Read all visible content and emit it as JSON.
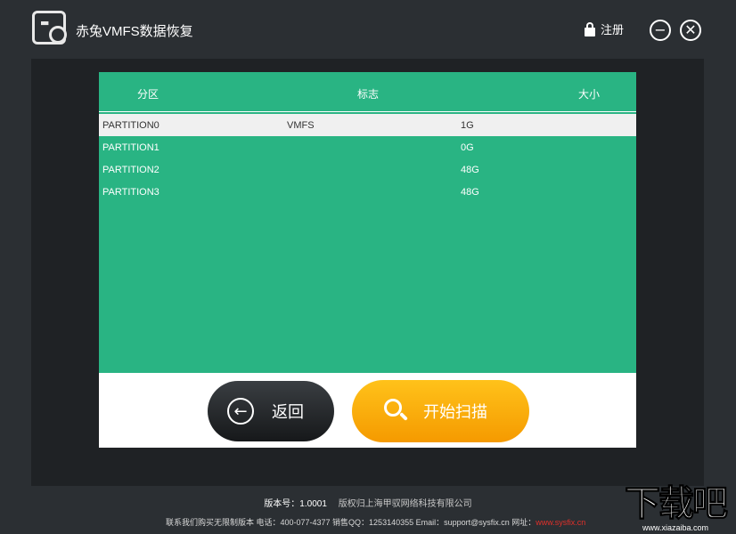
{
  "window": {
    "title": "赤兔VMFS数据恢复",
    "register_label": "注册",
    "minimize_icon": "minus-circle-icon",
    "close_icon": "x-circle-icon"
  },
  "table": {
    "headers": [
      "分区",
      "标志",
      "大小"
    ],
    "rows": [
      {
        "partition": "PARTITION0",
        "flag": "VMFS",
        "size": "1G",
        "selected": true
      },
      {
        "partition": "PARTITION1",
        "flag": "",
        "size": "0G",
        "selected": false
      },
      {
        "partition": "PARTITION2",
        "flag": "",
        "size": "48G",
        "selected": false
      },
      {
        "partition": "PARTITION3",
        "flag": "",
        "size": "48G",
        "selected": false
      }
    ]
  },
  "buttons": {
    "back_label": "返回",
    "scan_label": "开始扫描"
  },
  "footer": {
    "version": "版本号：1.0001",
    "copyright": "版权归上海甲驭网络科技有限公司",
    "contact": "联系我们购买无限制版本  电话：400-077-4377 销售QQ：1253140355 Email：support@sysfix.cn 网址：",
    "website": "www.sysfix.cn"
  },
  "watermark": {
    "big": "下载吧",
    "small": "www.xiazaiba.com"
  },
  "colors": {
    "background": "#2b2f33",
    "table_green": "#29b483",
    "scan_orange": "#f9a80c",
    "back_dark": "#222528"
  }
}
